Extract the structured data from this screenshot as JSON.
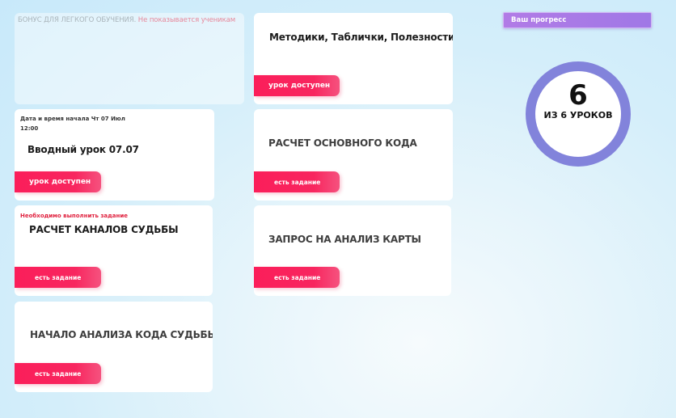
{
  "bonus_card": {
    "label": "БОНУС ДЛЯ ЛЕГКОГО ОБУЧЕНИЯ.",
    "warning": "Не показывается ученикам"
  },
  "lessons": {
    "methods": {
      "title": "Методики, Таблички, Полезности",
      "button": "урок доступен"
    },
    "intro": {
      "meta_line1": "Дата и время начала Чт 07 Июл",
      "meta_line2": "12:00",
      "title": "Вводный урок 07.07",
      "button": "урок доступен"
    },
    "main_code": {
      "title": "РАСЧЕТ ОСНОВНОГО КОДА",
      "button": "есть задание"
    },
    "channels": {
      "notice": "Необходимо выполнить задание",
      "title": "РАСЧЕТ КАНАЛОВ СУДЬБЫ",
      "button": "есть задание"
    },
    "map_request": {
      "title": "ЗАПРОС НА АНАЛИЗ КАРТЫ",
      "button": "есть задание"
    },
    "code_analysis": {
      "title": "НАЧАЛО АНАЛИЗА КОДА СУДЬБЫ",
      "button": "есть задание"
    }
  },
  "progress": {
    "header": "Ваш прогресс",
    "count": "6",
    "label": "ИЗ 6 УРОКОВ",
    "ring_color": "#8283db",
    "accent_color": "#fb1e5a"
  }
}
